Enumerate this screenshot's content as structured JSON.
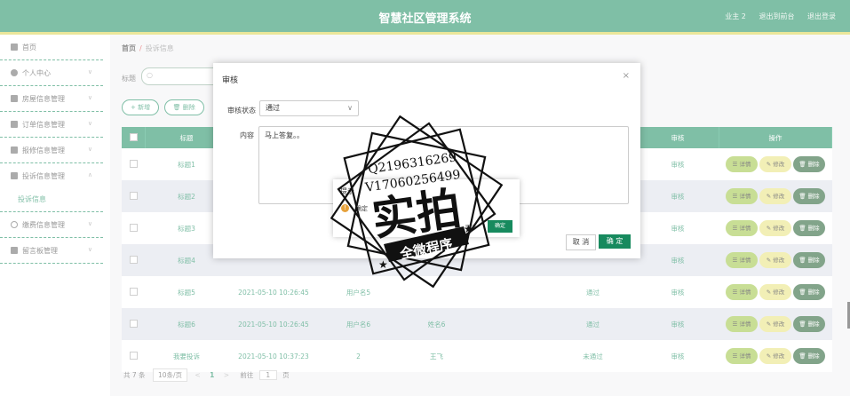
{
  "header": {
    "title": "智慧社区管理系统",
    "user": "业主 2",
    "back_to_front": "退出到前台",
    "logout": "退出登录"
  },
  "sidebar": {
    "items": [
      {
        "label": "首页",
        "icon": "home-icon",
        "has_arrow": false
      },
      {
        "label": "个人中心",
        "icon": "user-icon",
        "has_arrow": true
      },
      {
        "label": "房屋信息管理",
        "icon": "house-icon",
        "has_arrow": true
      },
      {
        "label": "订单信息管理",
        "icon": "grid-icon",
        "has_arrow": true
      },
      {
        "label": "报修信息管理",
        "icon": "wrench-icon",
        "has_arrow": true
      },
      {
        "label": "投诉信息管理",
        "icon": "bank-icon",
        "has_arrow": true,
        "expanded": true
      }
    ],
    "sub_item": "投诉信息",
    "items_after": [
      {
        "label": "缴费信息管理",
        "icon": "circle-icon",
        "has_arrow": true
      },
      {
        "label": "留言板管理",
        "icon": "doc-icon",
        "has_arrow": true
      }
    ]
  },
  "breadcrumb": {
    "home": "首页",
    "sep": "/",
    "current": "投诉信息"
  },
  "search": {
    "label": "标题",
    "placeholder": ""
  },
  "toolbar": {
    "add": "+ 新增",
    "delete": "🗑 删除"
  },
  "table": {
    "headers": [
      "",
      "标题",
      "",
      "",
      "",
      "",
      "",
      "审核",
      "操作"
    ],
    "rows": [
      {
        "title": "标题1",
        "time": "",
        "user": "",
        "name": "",
        "status": "",
        "audit": "审核"
      },
      {
        "title": "标题2",
        "time": "",
        "user": "",
        "name": "",
        "status": "",
        "audit": "审核"
      },
      {
        "title": "标题3",
        "time": "",
        "user": "",
        "name": "",
        "status": "",
        "audit": "审核"
      },
      {
        "title": "标题4",
        "time": "",
        "user": "",
        "name": "",
        "status": "",
        "audit": "审核"
      },
      {
        "title": "标题5",
        "time": "2021-05-10 10:26:45",
        "user": "用户名5",
        "name": "",
        "status": "通过",
        "audit": "审核"
      },
      {
        "title": "标题6",
        "time": "2021-05-10 10:26:45",
        "user": "用户名6",
        "name": "姓名6",
        "status": "通过",
        "audit": "审核"
      },
      {
        "title": "我要投诉",
        "time": "2021-05-10 10:37:23",
        "user": "2",
        "name": "王飞",
        "status": "未通过",
        "audit": "审核"
      }
    ],
    "actions": {
      "detail": "详情",
      "edit": "修改",
      "delete": "删除"
    }
  },
  "pager": {
    "total": "共 7 条",
    "size": "10条/页",
    "prev": "<",
    "page": "1",
    "next": ">",
    "goto": "前往",
    "goto_value": "1",
    "page_unit": "页"
  },
  "modal": {
    "title": "审核",
    "close": "×",
    "status_label": "审核状态",
    "status_value": "通过",
    "content_label": "内容",
    "content_value": "马上答复。。",
    "cancel": "取 消",
    "ok": "确 定"
  },
  "confirm": {
    "title": "提示",
    "message": "确定",
    "cancel": "取消",
    "ok": "确定"
  },
  "watermark": {
    "line1": "Q2196316269",
    "line2": "V17060256499",
    "big": "实拍",
    "banner": "全微程序"
  },
  "colors": {
    "primary": "#178a5e",
    "accent": "#d9d248",
    "detail": "#9cc43e",
    "edit": "#e8e27a",
    "delete": "#1d5a2b"
  }
}
